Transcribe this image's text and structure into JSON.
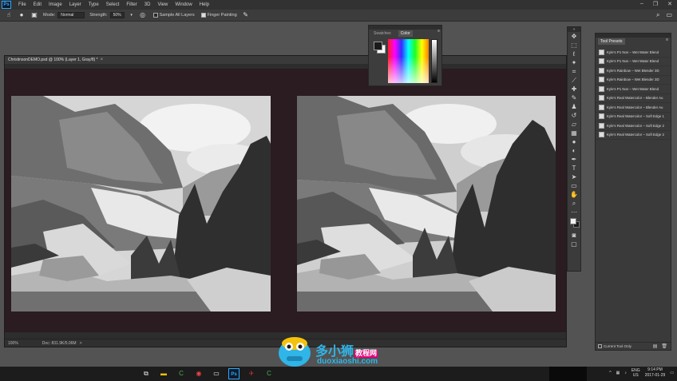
{
  "app": {
    "logo_text": "Ps"
  },
  "menubar": {
    "items": [
      "File",
      "Edit",
      "Image",
      "Layer",
      "Type",
      "Select",
      "Filter",
      "3D",
      "View",
      "Window",
      "Help"
    ],
    "window_controls": [
      "–",
      "❐",
      "✕"
    ]
  },
  "options": {
    "mode_label": "Mode:",
    "mode_value": "Normal",
    "strength_label": "Strength:",
    "strength_value": "50%",
    "sample_all_layers": "Sample All Layers",
    "finger_painting": "Finger Painting",
    "finger_painting_checked": true
  },
  "document": {
    "tab_title": "ChristinsonDEMO.psd @ 100% (Layer 1, Gray/8) *",
    "close_glyph": "×",
    "zoom": "100%",
    "doc_size": "Doc: 831.9K/5.06M",
    "arrow": ">"
  },
  "color_panel": {
    "tabs": [
      "Swatches",
      "Color"
    ],
    "active_tab": "Color",
    "menu_glyph": "≡"
  },
  "presets_panel": {
    "title": "Tool Presets",
    "menu_glyph": "≡",
    "items": [
      "Kyle's P1 Nos – Wet Water Blend",
      "Kyle's P1 Nos – Wet Water Blend",
      "Kyle's Rainbow – Wet Blender 3D",
      "Kyle's Rainbow – Wet Blender 3D",
      "Kyle's P1 Nos – Wet Water Blend",
      "Kyle's Real Watercolor – Blender Au",
      "Kyle's Real Watercolor – Blender Au",
      "Kyle's Real Watercolor – Soft Edge 1",
      "Kyle's Real Watercolor – Soft Edge 2",
      "Kyle's Real Watercolor – Soft Edge 2"
    ],
    "current_tool_only": "Current Tool Only"
  },
  "watermark": {
    "name": "多小狮",
    "sub": "教程网",
    "url": "duoxiaoshi.com"
  },
  "taskbar": {
    "lang_line1": "ENG",
    "lang_line2": "US",
    "time": "9:14 PM",
    "date": "2017-01-29"
  },
  "colors": {
    "ps_accent": "#31a8ff",
    "watermark_blue": "#2fb5e8",
    "canvas_background": "#2a1c20"
  }
}
